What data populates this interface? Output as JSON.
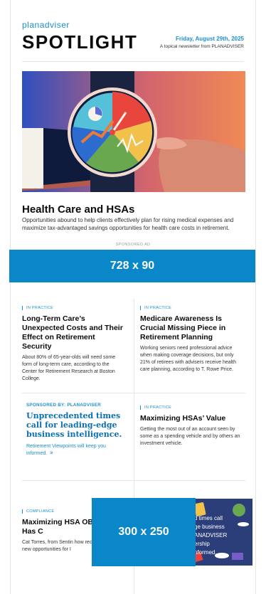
{
  "header": {
    "brand": "planadviser",
    "title": "SPOTLIGHT",
    "date": "Friday, August 29th, 2025",
    "subtitle": "A topical newsletter from PLANADVISER"
  },
  "hero": {
    "heading": "Health Care and HSAs",
    "description": "Opportunities abound to help clients effectively plan for rising medical expenses and maximize tax-advantaged savings opportunities for health care costs in retirement."
  },
  "ads": {
    "sponsored_label": "SPONSORED AD",
    "leaderboard": "728 x 90",
    "rectangle": "300 x 250",
    "sponsor_creative": "d times call\nge business\nANADVISER\nership\nnformed."
  },
  "cards": [
    {
      "kicker": "IN PRACTICE",
      "title": "Long-Term Care’s Unexpected Costs and Their Effect on Retirement Security",
      "text": "About 80% of 65-year-olds will need some form of long-term care, according to the Center for Retirement Research at Boston College."
    },
    {
      "kicker": "IN PRACTICE",
      "title": "Medicare Awareness Is Crucial Missing Piece in Retirement Planning",
      "text": "Working seniors need professional advice when making coverage decisions, but only 21% of retirees with advisers receive health care planning, according to T. Rowe Price."
    },
    {
      "kicker": "IN PRACTICE",
      "title": "Maximizing HSAs’ Value",
      "text": "Getting the most out of an account seen by some as a spending vehicle and by others an investment vehicle."
    },
    {
      "kicker": "COMPLIANCE",
      "title": "Maximizing HSA OBBB Act Has C",
      "text": "Cat Torres, from Sentin how recent developme new opportunities for I"
    }
  ],
  "sponsor": {
    "kicker": "SPONSORED BY: PLANADVISER",
    "title": "Unprecedented times call for leading-edge business intelligence.",
    "text": "Retirement Viewpoints will keep you informed.",
    "chevron": ">"
  },
  "colors": {
    "accent": "#1a8fd2",
    "ad_blue": "#0a87c9",
    "sponsor_bg": "#2c3e7a"
  }
}
